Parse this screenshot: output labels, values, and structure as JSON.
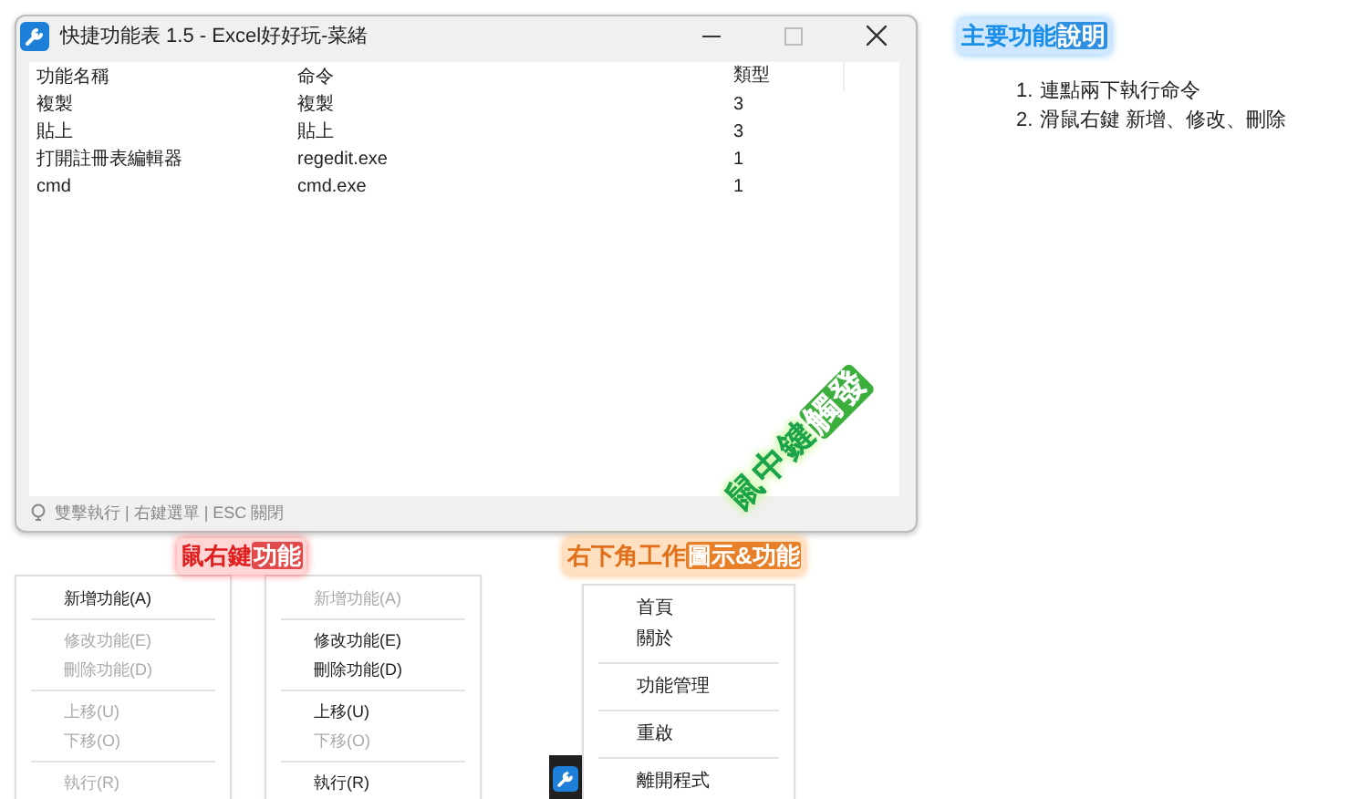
{
  "window": {
    "title": "快捷功能表 1.5  - Excel好好玩-菜緒"
  },
  "table": {
    "columns": [
      "功能名稱",
      "命令",
      "類型"
    ],
    "rows": [
      [
        "複製",
        "複製",
        "3"
      ],
      [
        "貼上",
        "貼上",
        "3"
      ],
      [
        "打開註冊表編輯器",
        "regedit.exe",
        "1"
      ],
      [
        "cmd",
        "cmd.exe",
        "1"
      ]
    ]
  },
  "overlay_label": {
    "highlight": "鼠中鍵",
    "rest": "觸發"
  },
  "status_bar": "雙擊執行 | 右鍵選單 | ESC 關閉",
  "help": {
    "title": {
      "highlight": "主要功能",
      "rest": "說明"
    },
    "items": [
      {
        "number": "1.",
        "text": "連點兩下執行命令"
      },
      {
        "number": "2.",
        "text": "滑鼠右鍵 新增、修改、刪除"
      }
    ]
  },
  "context_menus_label": {
    "highlight": "鼠右鍵",
    "rest": "功能"
  },
  "context_menus": [
    {
      "items": [
        {
          "kind": "item",
          "label": "新增功能(A)",
          "disabled": false
        },
        {
          "kind": "separator"
        },
        {
          "kind": "item",
          "label": "修改功能(E)",
          "disabled": true
        },
        {
          "kind": "item",
          "label": "刪除功能(D)",
          "disabled": true
        },
        {
          "kind": "separator"
        },
        {
          "kind": "item",
          "label": "上移(U)",
          "disabled": true
        },
        {
          "kind": "item",
          "label": "下移(O)",
          "disabled": true
        },
        {
          "kind": "separator"
        },
        {
          "kind": "item",
          "label": "執行(R)",
          "disabled": true
        }
      ]
    },
    {
      "items": [
        {
          "kind": "item",
          "label": "新增功能(A)",
          "disabled": true
        },
        {
          "kind": "separator"
        },
        {
          "kind": "item",
          "label": "修改功能(E)",
          "disabled": false
        },
        {
          "kind": "item",
          "label": "刪除功能(D)",
          "disabled": false
        },
        {
          "kind": "separator"
        },
        {
          "kind": "item",
          "label": "上移(U)",
          "disabled": false
        },
        {
          "kind": "item",
          "label": "下移(O)",
          "disabled": true
        },
        {
          "kind": "separator"
        },
        {
          "kind": "item",
          "label": "執行(R)",
          "disabled": false
        }
      ]
    }
  ],
  "tray_label": {
    "highlight": "右下角工作",
    "rest": "圖示&功能"
  },
  "tray_menu": {
    "items": [
      {
        "kind": "item",
        "label": "首頁",
        "disabled": false
      },
      {
        "kind": "item",
        "label": "關於",
        "disabled": false
      },
      {
        "kind": "separator"
      },
      {
        "kind": "item",
        "label": "功能管理",
        "disabled": false
      },
      {
        "kind": "separator"
      },
      {
        "kind": "item",
        "label": "重啟",
        "disabled": false
      },
      {
        "kind": "separator"
      },
      {
        "kind": "item",
        "label": "離開程式",
        "disabled": false
      }
    ]
  }
}
